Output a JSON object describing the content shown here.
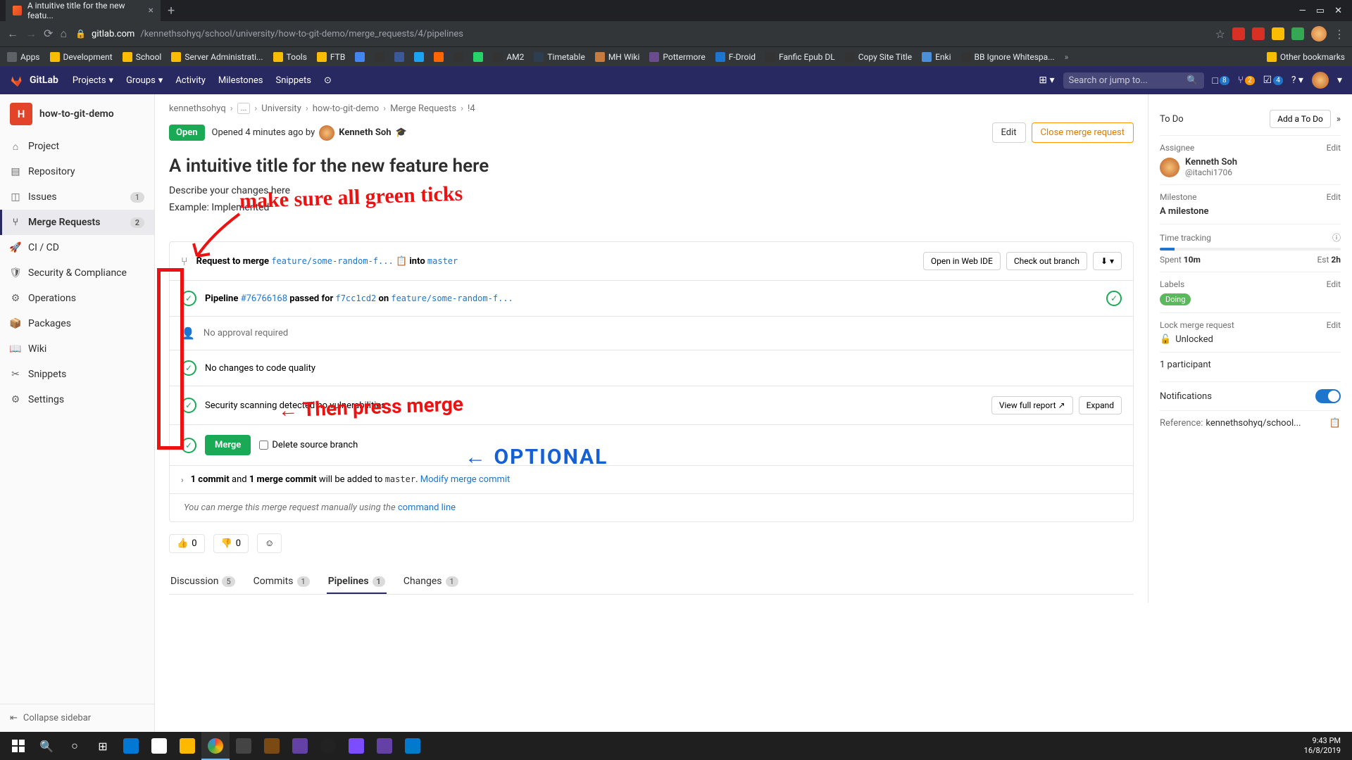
{
  "browser": {
    "tab_title": "A intuitive title for the new featu...",
    "url_domain": "gitlab.com",
    "url_path": "/kennethsohyq/school/university/how-to-git-demo/merge_requests/4/pipelines"
  },
  "bookmarks": [
    "Apps",
    "Development",
    "School",
    "Server Administrati...",
    "Tools",
    "FTB",
    "AM2",
    "Timetable",
    "MH Wiki",
    "Pottermore",
    "F-Droid",
    "Fanfic Epub DL",
    "Copy Site Title",
    "Enki",
    "BB Ignore Whitespa..."
  ],
  "bookmarks_other": "Other bookmarks",
  "gitlab_nav": {
    "brand": "GitLab",
    "items": [
      "Projects",
      "Groups",
      "Activity",
      "Milestones",
      "Snippets"
    ],
    "search_placeholder": "Search or jump to...",
    "badge_issues": "8",
    "badge_mrs": "2",
    "badge_todo": "4"
  },
  "sidebar": {
    "project_letter": "H",
    "project_name": "how-to-git-demo",
    "items": [
      {
        "label": "Project"
      },
      {
        "label": "Repository"
      },
      {
        "label": "Issues",
        "badge": "1"
      },
      {
        "label": "Merge Requests",
        "badge": "2"
      },
      {
        "label": "CI / CD"
      },
      {
        "label": "Security & Compliance"
      },
      {
        "label": "Operations"
      },
      {
        "label": "Packages"
      },
      {
        "label": "Wiki"
      },
      {
        "label": "Snippets"
      },
      {
        "label": "Settings"
      }
    ],
    "collapse": "Collapse sidebar"
  },
  "breadcrumb": [
    "kennethsohyq",
    "...",
    "University",
    "how-to-git-demo",
    "Merge Requests",
    "!4"
  ],
  "mr": {
    "status": "Open",
    "opened_text": "Opened 4 minutes ago by",
    "author": "Kenneth Soh",
    "edit": "Edit",
    "close": "Close merge request",
    "title": "A intuitive title for the new feature here",
    "desc1": "Describe your changes here",
    "desc2": "Example: Implemented",
    "request_merge": "Request to merge",
    "source_branch": "feature/some-random-f...",
    "into": "into",
    "target_branch": "master",
    "open_ide": "Open in Web IDE",
    "checkout": "Check out branch",
    "pipeline_label": "Pipeline",
    "pipeline_id": "#76766168",
    "pipeline_passed": "passed for",
    "pipeline_sha": "f7cc1cd2",
    "pipeline_on": "on",
    "pipeline_branch": "feature/some-random-f...",
    "approval": "No approval required",
    "code_quality": "No changes to code quality",
    "security": "Security scanning detected no vulnerabilities",
    "view_report": "View full report",
    "expand": "Expand",
    "merge_btn": "Merge",
    "delete_source": "Delete source branch",
    "commit_text_1": "1 commit",
    "commit_text_and": "and",
    "commit_text_2": "1 merge commit",
    "commit_text_3": "will be added to",
    "commit_master": "master",
    "modify_commit": "Modify merge commit",
    "manual_merge": "You can merge this merge request manually using the",
    "command_line": "command line",
    "thumbs_up": "0",
    "thumbs_down": "0"
  },
  "tabs": [
    {
      "label": "Discussion",
      "count": "5"
    },
    {
      "label": "Commits",
      "count": "1"
    },
    {
      "label": "Pipelines",
      "count": "1"
    },
    {
      "label": "Changes",
      "count": "1"
    }
  ],
  "details": {
    "todo_label": "To Do",
    "add_todo": "Add a To Do",
    "assignee_label": "Assignee",
    "assignee_name": "Kenneth Soh",
    "assignee_handle": "@itachi1706",
    "milestone_label": "Milestone",
    "milestone_value": "A milestone",
    "time_tracking": "Time tracking",
    "spent": "Spent",
    "spent_val": "10m",
    "est": "Est",
    "est_val": "2h",
    "labels_label": "Labels",
    "label_chip": "Doing",
    "lock_label": "Lock merge request",
    "lock_val": "Unlocked",
    "participants": "1 participant",
    "notifications": "Notifications",
    "reference_label": "Reference:",
    "reference_val": "kennethsohyq/school..."
  },
  "annotations": {
    "red1": "make sure all green ticks",
    "red2": "Then press merge",
    "blue1": "OPTIONAL"
  },
  "taskbar": {
    "time": "9:43 PM",
    "date": "16/8/2019"
  }
}
